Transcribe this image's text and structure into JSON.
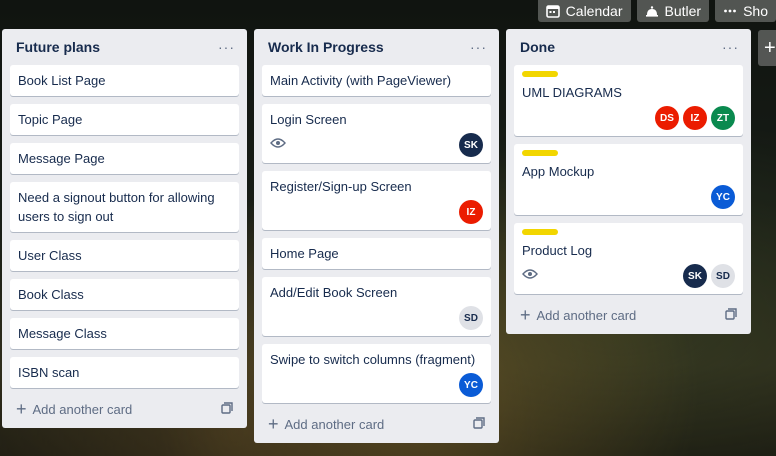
{
  "topbar": {
    "calendar_label": "Calendar",
    "butler_label": "Butler",
    "show_label": "Sho"
  },
  "add_list_label": "+",
  "lists": [
    {
      "title": "Future plans",
      "menu": "···",
      "add_card": "Add another card",
      "cards": [
        {
          "title": "Book List Page"
        },
        {
          "title": "Topic Page"
        },
        {
          "title": "Message Page"
        },
        {
          "title": "Need a signout button for allowing users to sign out"
        },
        {
          "title": "User Class"
        },
        {
          "title": "Book Class"
        },
        {
          "title": "Message Class"
        },
        {
          "title": "ISBN scan"
        }
      ]
    },
    {
      "title": "Work In Progress",
      "menu": "···",
      "add_card": "Add another card",
      "cards": [
        {
          "title": "Main Activity (with PageViewer)"
        },
        {
          "title": "Login Screen",
          "watch": true,
          "members": [
            "SK"
          ]
        },
        {
          "title": "Register/Sign-up Screen",
          "members": [
            "IZ"
          ]
        },
        {
          "title": "Home Page"
        },
        {
          "title": "Add/Edit Book Screen",
          "members": [
            "SD"
          ]
        },
        {
          "title": "Swipe to switch columns (fragment)",
          "members": [
            "YC"
          ]
        }
      ]
    },
    {
      "title": "Done",
      "menu": "···",
      "add_card": "Add another card",
      "cards": [
        {
          "title": "UML DIAGRAMS",
          "label_color": "#f2d600",
          "members": [
            "DS",
            "IZ",
            "ZT"
          ]
        },
        {
          "title": "App Mockup",
          "label_color": "#f2d600",
          "members": [
            "YC"
          ]
        },
        {
          "title": "Product Log",
          "label_color": "#f2d600",
          "watch": true,
          "members": [
            "SK",
            "SD"
          ]
        }
      ]
    }
  ],
  "member_colors": {
    "SK": {
      "bg": "#172b4d",
      "fg": "#ffffff"
    },
    "IZ": {
      "bg": "#eb1c00",
      "fg": "#ffffff"
    },
    "DS": {
      "bg": "#eb1c00",
      "fg": "#ffffff"
    },
    "ZT": {
      "bg": "#0a8a4f",
      "fg": "#ffffff"
    },
    "YC": {
      "bg": "#0a5bd6",
      "fg": "#ffffff"
    },
    "SD": {
      "bg": "#dfe1e6",
      "fg": "#172b4d"
    }
  },
  "icons": {
    "calendar": "calendar-icon",
    "butler": "butler-bell-icon",
    "show": "more-dots-icon",
    "watch": "eye-icon",
    "template": "card-template-icon",
    "menu": "list-menu-icon"
  }
}
